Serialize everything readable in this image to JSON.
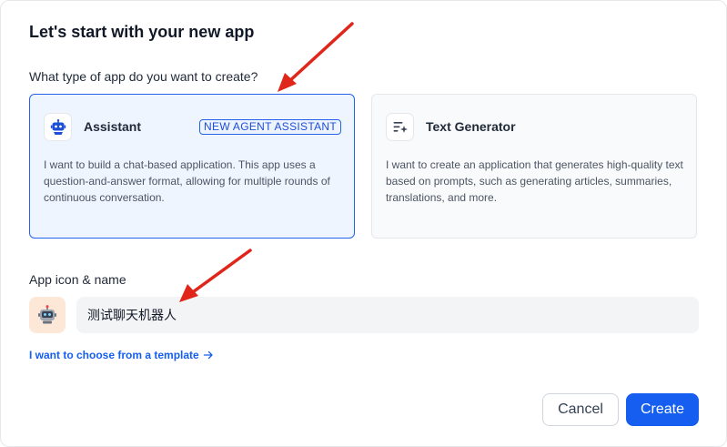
{
  "dialog": {
    "title": "Let's start with your new app"
  },
  "app_type": {
    "label": "What type of app do you want to create?",
    "options": [
      {
        "title": "Assistant",
        "badge": "NEW AGENT ASSISTANT",
        "description": "I want to build a chat-based application. This app uses a question-and-answer format, allowing for multiple rounds of continuous conversation.",
        "icon": "robot-icon",
        "selected": true
      },
      {
        "title": "Text Generator",
        "description": "I want to create an application that generates high-quality text based on prompts, such as generating articles, summaries, translations, and more.",
        "icon": "text-sparkle-icon",
        "selected": false
      }
    ]
  },
  "app_name": {
    "label": "App icon & name",
    "icon": "robot-emoji-icon",
    "value": "测试聊天机器人"
  },
  "template_link": {
    "label": "I want to choose from a template",
    "icon": "arrow-right-icon"
  },
  "footer": {
    "cancel_label": "Cancel",
    "create_label": "Create"
  },
  "colors": {
    "accent": "#155eef",
    "selected_card_bg": "#eff5fe",
    "app_icon_bg": "#fde7d6",
    "annotation_arrow": "#e0261b"
  }
}
